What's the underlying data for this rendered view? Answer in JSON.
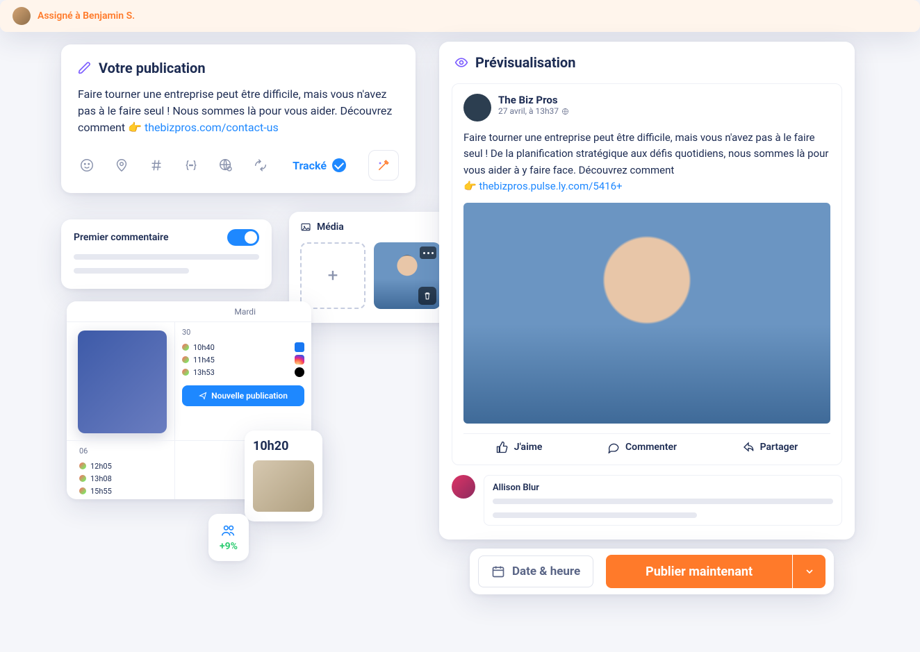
{
  "composer": {
    "title": "Votre publication",
    "body_pre": "Faire tourner une entreprise peut être difficile, mais vous n'avez pas à le faire seul ! Nous sommes là pour vous aider. Découvrez comment ",
    "emoji": "👉",
    "link_text": "thebizpros.com/contact-us",
    "tracked_label": "Tracké"
  },
  "first_comment": {
    "label": "Premier commentaire",
    "enabled": true
  },
  "media": {
    "title": "Média"
  },
  "calendar": {
    "day_label": "Mardi",
    "top_daynum": "30",
    "bottom_daynum": "06",
    "top_events": [
      {
        "time": "10h40",
        "network": "fb"
      },
      {
        "time": "11h45",
        "network": "ig"
      },
      {
        "time": "13h53",
        "network": "tt"
      }
    ],
    "bottom_events": [
      {
        "time": "12h05",
        "network": "li"
      },
      {
        "time": "13h08",
        "network": "x"
      },
      {
        "time": "15h55",
        "network": "yt"
      }
    ],
    "new_pub_label": "Nouvelle publication"
  },
  "time_card": {
    "time": "10h20"
  },
  "audience": {
    "delta": "+9%"
  },
  "assigned": {
    "text": "Assigné à Benjamin S."
  },
  "preview": {
    "title": "Prévisualisation",
    "author_name": "The Biz Pros",
    "timestamp": "27 avril, à 13h37",
    "body_pre": "Faire tourner une entreprise peut être difficile, mais vous n'avez pas à le faire seul ! De la planification stratégique aux défis quotidiens, nous sommes là pour vous aider à y faire face. Découvrez comment",
    "emoji": "👉",
    "link_text": "thebizpros.pulse.ly.com/5416+",
    "actions": {
      "like": "J'aime",
      "comment": "Commenter",
      "share": "Partager"
    },
    "commenter_name": "Allison Blur"
  },
  "publish_bar": {
    "date_label": "Date & heure",
    "publish_label": "Publier maintenant"
  }
}
